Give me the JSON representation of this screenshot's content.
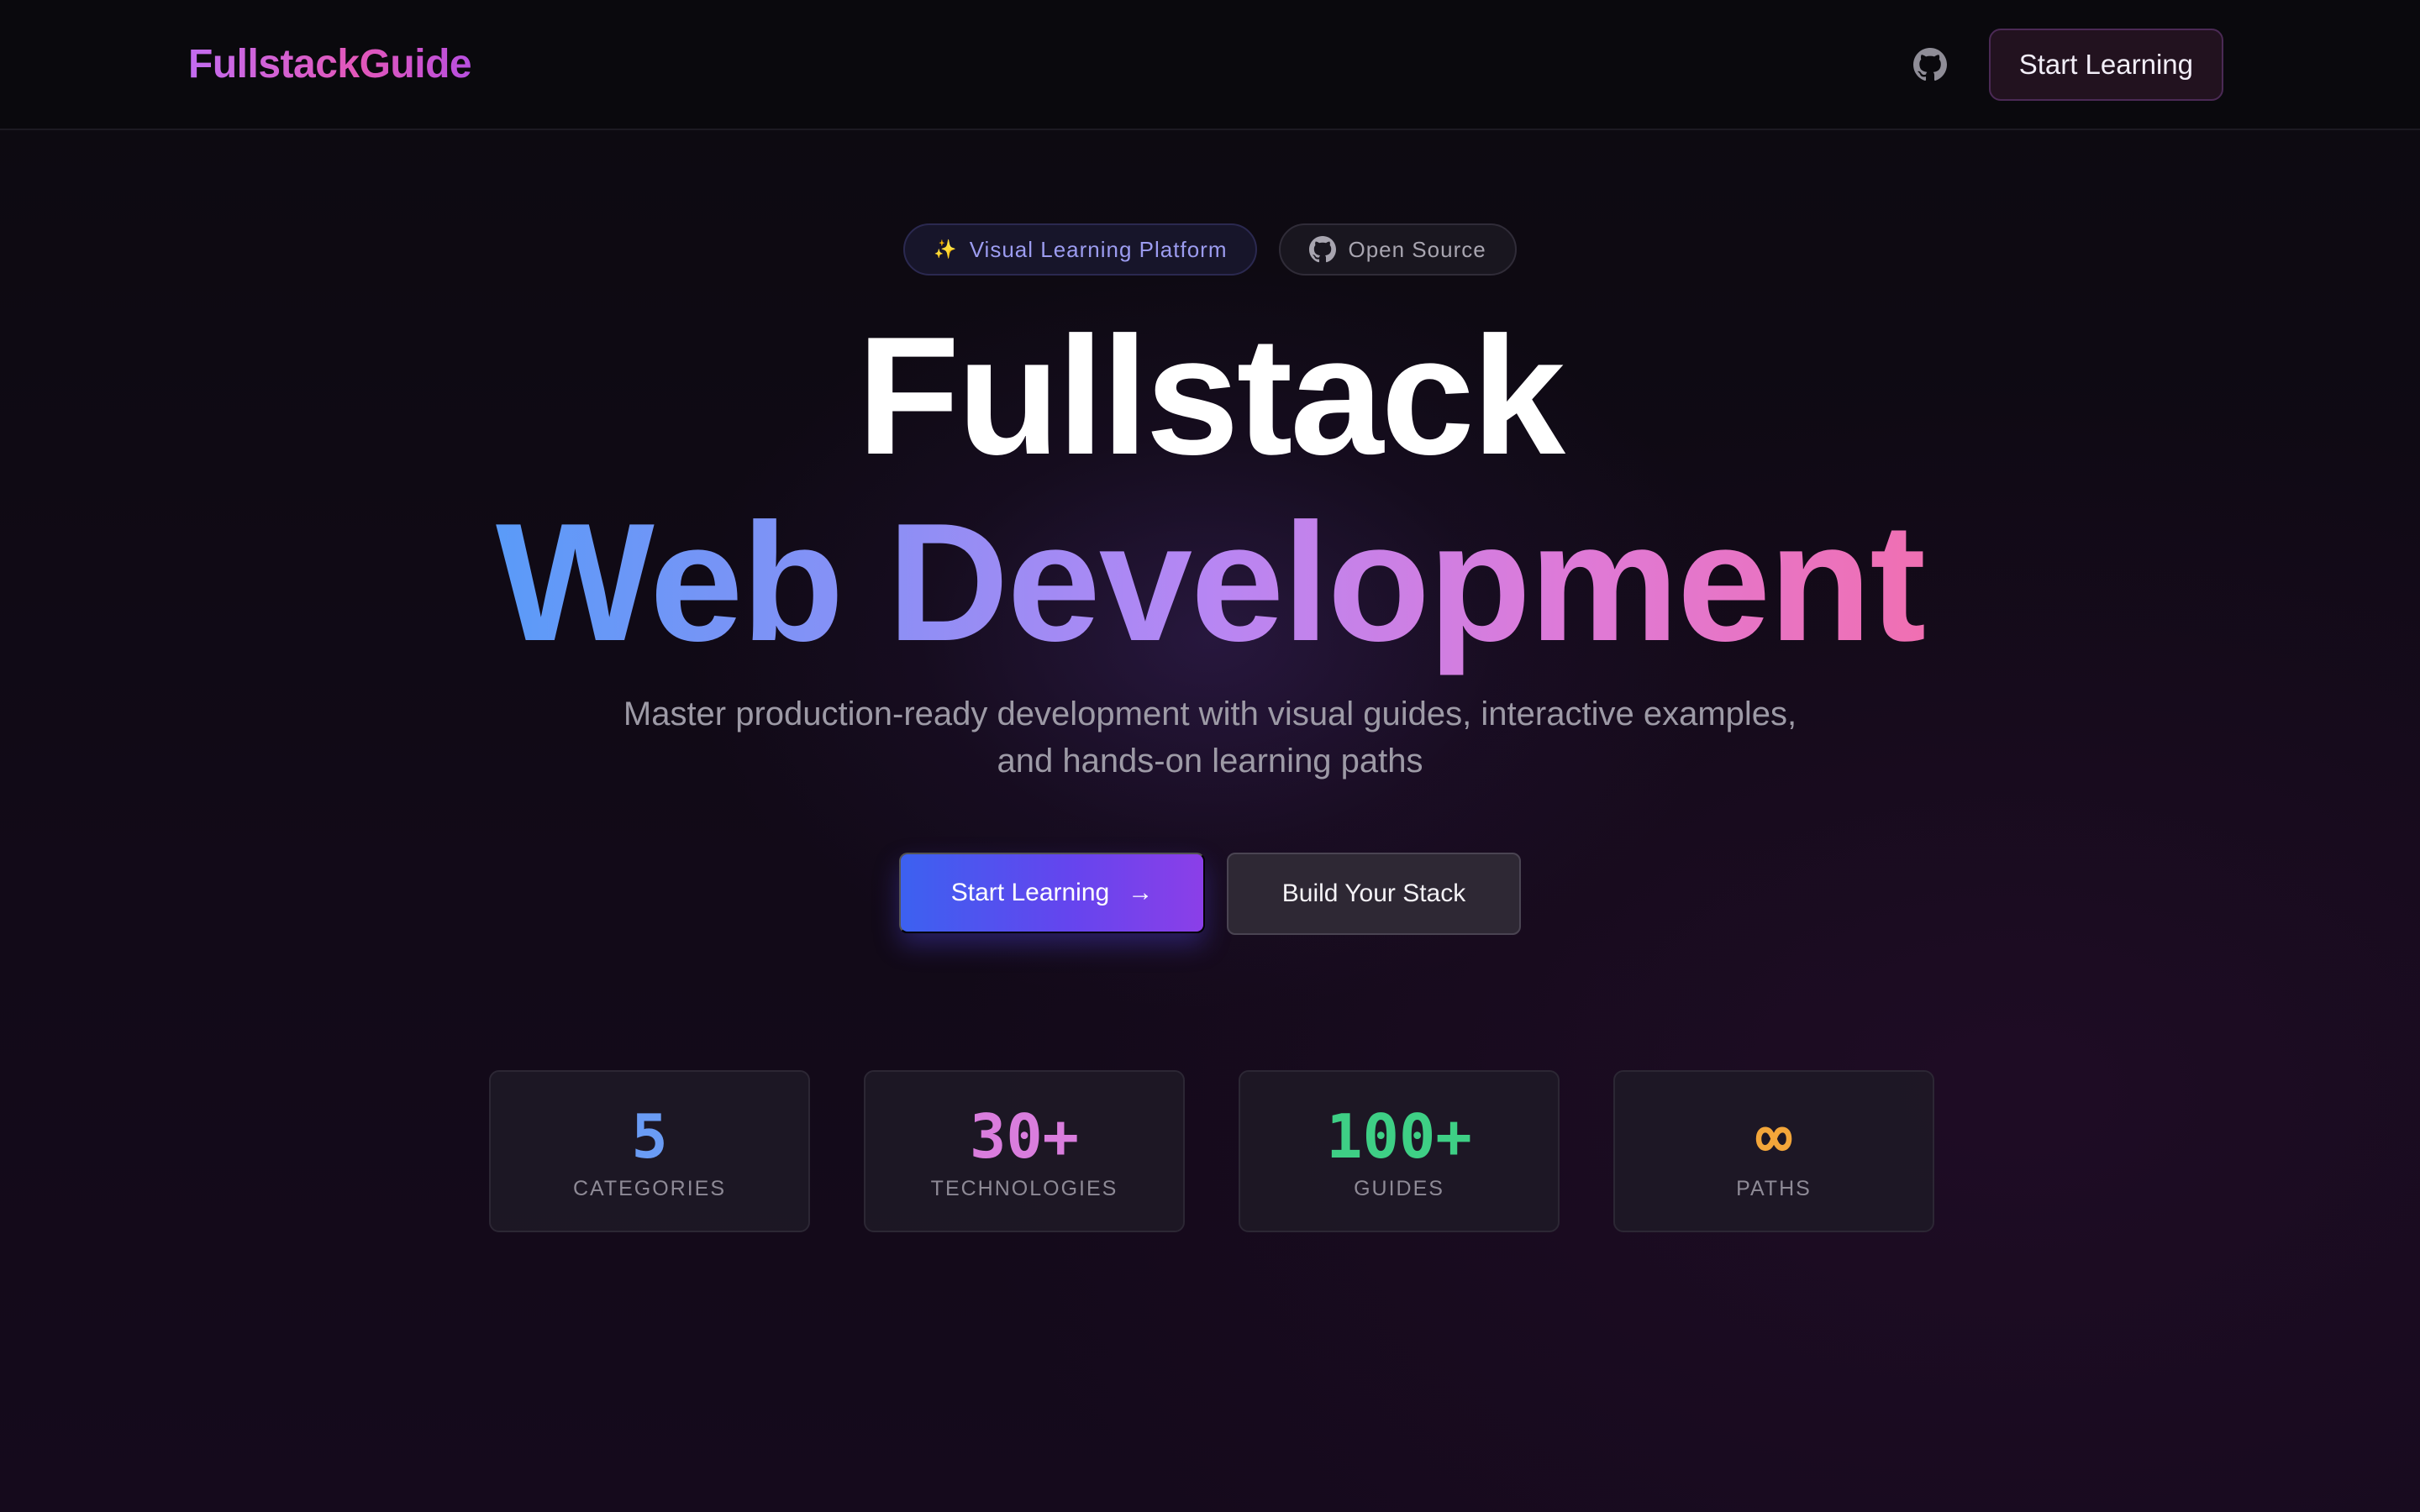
{
  "nav": {
    "brand": "FullstackGuide",
    "github_icon": "github-icon",
    "cta_label": "Start Learning"
  },
  "badges": [
    {
      "icon": "sparkle-icon",
      "label": "Visual Learning Platform"
    },
    {
      "icon": "github-icon",
      "label": "Open Source"
    }
  ],
  "hero": {
    "title_line1": "Fullstack",
    "title_line2": "Web Development",
    "subtitle": "Master production-ready development with visual guides, interactive examples, and hands-on learning paths"
  },
  "cta": {
    "primary_label": "Start Learning",
    "primary_icon": "arrow-right-icon",
    "secondary_label": "Build Your Stack"
  },
  "stats": [
    {
      "value": "5",
      "label": "CATEGORIES",
      "color": "#6a9cf5"
    },
    {
      "value": "30+",
      "label": "TECHNOLOGIES",
      "color": "#d97ddd"
    },
    {
      "value": "100+",
      "label": "GUIDES",
      "color": "#3ecf85"
    },
    {
      "value": "∞",
      "label": "PATHS",
      "color": "#f3a63a"
    }
  ],
  "colors": {
    "background": "#0b090f",
    "primary_gradient_start": "#3c61f0",
    "primary_gradient_end": "#8b3fe8",
    "brand_pink": "#e357b9"
  }
}
